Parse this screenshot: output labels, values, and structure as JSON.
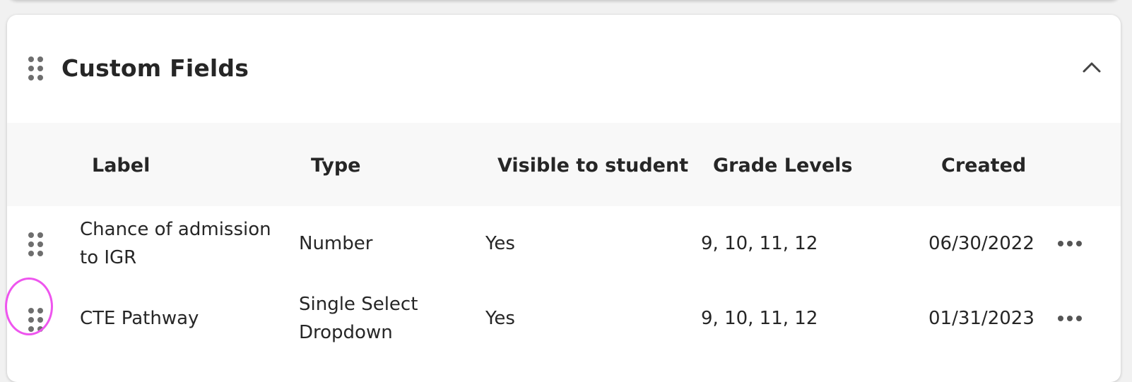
{
  "section": {
    "title": "Custom Fields",
    "collapse_icon": "chevron-up-icon"
  },
  "table": {
    "columns": [
      "Label",
      "Type",
      "Visible to student",
      "Grade Levels",
      "Created"
    ],
    "rows": [
      {
        "label_line1": "Chance of admission",
        "label_line2": "to IGR",
        "type_line1": "Number",
        "type_line2": "",
        "visible": "Yes",
        "grades": "9, 10, 11, 12",
        "created": "06/30/2022"
      },
      {
        "label_line1": "CTE Pathway",
        "label_line2": "",
        "type_line1": "Single Select",
        "type_line2": "Dropdown",
        "visible": "Yes",
        "grades": "9, 10, 11, 12",
        "created": "01/31/2023"
      }
    ]
  },
  "colors": {
    "annotation": "#ee55ee",
    "header_bg": "#f8f8f8"
  }
}
